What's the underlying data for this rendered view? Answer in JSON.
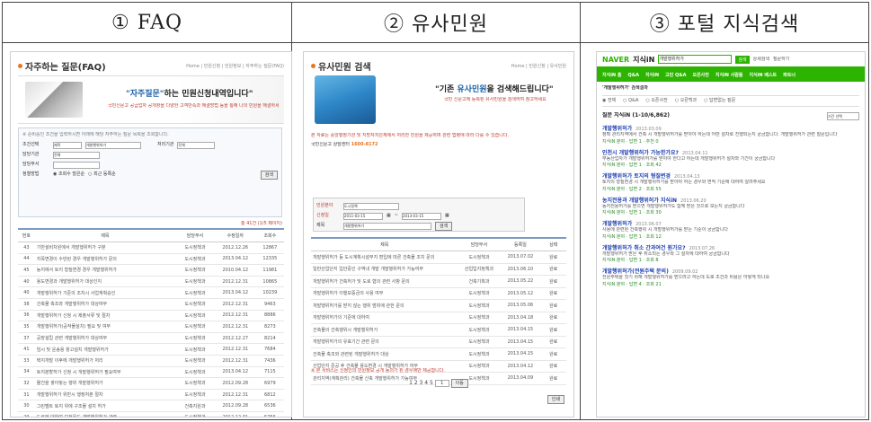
{
  "headers": [
    "① FAQ",
    "② 유사민원",
    "③ 포털 지식검색"
  ],
  "faq": {
    "title": "자주하는 질문(FAQ)",
    "breadcrumb": "Home | 민원신청 | 민원정보 | 자주하는 질문(FAQ)",
    "slogan_pre": "\"자주질문\"",
    "slogan_post": "하는 민원신청내역입니다\"",
    "subtext": "국민신문고 공급업자 공개창을 다양한 고객만족과 해결방법 등을 통해 나의 민원을 해결하세요",
    "form": {
      "notice": "※ 준비중인 조건을 입력하시면 아래에 해당 자주하는 질문 목록을 조회합니다.",
      "label_search": "조건선택",
      "select_value": "제목",
      "input_value": "개발행위허가",
      "label_category": "처리기관",
      "category_value": "전체",
      "label_org": "담당기관",
      "org_value": "전체",
      "label_dept": "담당부서",
      "label_sort": "정렬방법",
      "sort_options": [
        "조회수 많은순",
        "최근 등록순"
      ],
      "search_button": "검색"
    },
    "count_text": "총 41건 (1/5 페이지)",
    "columns": [
      "번호",
      "제목",
      "담당부서",
      "수정일자",
      "조회수"
    ],
    "rows": [
      [
        "43",
        "기반설비차원에서 개발행위허가 구분",
        "도시정책과",
        "2012.12.26",
        "12867"
      ],
      [
        "44",
        "지목변경이 수반된 경우 개발행위허가 문의",
        "도시정책과",
        "2013.04.12",
        "12335"
      ],
      [
        "45",
        "농지에서 토지 형질변경 경우 개발행위허가",
        "도시정책과",
        "2010.04.12",
        "11981"
      ],
      [
        "40",
        "용도변경과 개발행위허가 대상인지",
        "도시정책과",
        "2012.12.31",
        "10865"
      ],
      [
        "40",
        "개발행위허가 기준의 조치시 사업계획승인",
        "도시정책과",
        "2013.04.12",
        "10239"
      ],
      [
        "38",
        "건축물 축조와 개발행위허가 대상여부",
        "도시정책과",
        "2012.12.31",
        "9463"
      ],
      [
        "36",
        "개발행위허가 신청 시 제출서류 및 절차",
        "도시정책과",
        "2012.12.31",
        "8886"
      ],
      [
        "35",
        "개발행위허가(공작물설치) 필요 및 여부",
        "도시정책과",
        "2012.12.31",
        "8273"
      ],
      [
        "37",
        "공장설립 관련 개발행위허가 대상여부",
        "도시정책과",
        "2012.12.27",
        "8214"
      ],
      [
        "41",
        "임시 및 운송용 창고설치 개발행위허가",
        "도시정책과",
        "2012.12.31",
        "7684"
      ],
      [
        "33",
        "택지개발 이후에 개발행위허가 처리",
        "도시정책과",
        "2012.12.31",
        "7436"
      ],
      [
        "34",
        "토지분할허가 신청 시 개발행위허가 필요여부",
        "도시정책과",
        "2013.04.12",
        "7115"
      ],
      [
        "32",
        "물건을 쌓아놓는 행위 개발행위허가",
        "도시정책과",
        "2012.09.28",
        "6979"
      ],
      [
        "31",
        "개발행위허가 위반시 행정처분 절차",
        "도시정책과",
        "2012.12.31",
        "6812"
      ],
      [
        "30",
        "그린벨트 토지 위에 구조물 설치 허가",
        "건축지원과",
        "2012.09.28",
        "6536"
      ],
      [
        "29",
        "도로에 대하여 보전용도 개발행위허가 관련",
        "도시정책과",
        "2012.12.31",
        "5756"
      ]
    ]
  },
  "similar": {
    "title": "유사민원 검색",
    "breadcrumb": "Home | 민원신청 | 유사민원",
    "slogan_pre": "\"기존 ",
    "slogan_mid": "유사민원",
    "slogan_post": "을 검색해드립니다\"",
    "subtext": "국민 신문고에 등록된 유사민원을 검색하여 참고하세요",
    "info_text": "본 자료는 중앙행정기관 및 지방자치단체에서 처리한 민원을 제공하며 관련 법령에 따라 다를 수 있습니다.",
    "phone_label": "국민신문고 상담센터",
    "phone": "1600-8172",
    "form": {
      "label_field": "민원분야",
      "field_value": "도시정책",
      "label_period": "신청일",
      "date_from": "2011-03-15",
      "date_to": "2013-03-15",
      "label_keyword": "제목",
      "keyword": "개발행위허가",
      "search_button": "검색"
    },
    "columns": [
      "제목",
      "담당부서",
      "등록일",
      "상태"
    ],
    "rows": [
      [
        "개발행위허가 등 도시계획시설부지 편입에 따른 건축물 조치 문의",
        "도시정책과",
        "2013.07.02",
        "완료"
      ],
      [
        "일반산업단지 입안중인 구역내 개발 개발행위허가 가능여부",
        "산업입지정책과",
        "2013.06.10",
        "완료"
      ],
      [
        "개발행위허가 건축허가 및 도로 협의 관련 사항 문의",
        "건축기획과",
        "2013.05.22",
        "완료"
      ],
      [
        "개발행위허가 이행보증금의 사용 여부",
        "도시정책과",
        "2013.05.12",
        "완료"
      ],
      [
        "개발행위허가를 받지 않는 행위 범위에 관한 문의",
        "도시정책과",
        "2013.05.06",
        "완료"
      ],
      [
        "개발행위허가의 기준에 대하여",
        "도시정책과",
        "2013.04.18",
        "완료"
      ],
      [
        "건축물의 건축행위시 개발행위허가",
        "도시정책과",
        "2013.04.15",
        "완료"
      ],
      [
        "개발행위허가의 유효기간 관련 문의",
        "도시정책과",
        "2013.04.15",
        "완료"
      ],
      [
        "건축물 축조와 관련된 개발행위허가 대상",
        "도시정책과",
        "2013.04.15",
        "완료"
      ],
      [
        "산업단지 준공 후 건축물 용도변경 시 개발행위허가 여부",
        "도시정책과",
        "2013.04.12",
        "완료"
      ],
      [
        "관리지역(계획관리) 건축물 신축 개발행위허가 가능여부",
        "도시정책과",
        "2013.04.09",
        "완료"
      ]
    ],
    "footer_note": "※ 본 서비스는 신청인의 민원정보 공개 동의가 된 경우에만 제공합니다.",
    "pages": "1 2 3 4 5",
    "page_select": "1",
    "go_button": "이동",
    "print_button": "인쇄"
  },
  "portal": {
    "logo": "NAVER",
    "logo2": "지식iN",
    "search_value": "개발행위허가",
    "search_button": "검색",
    "top_links": [
      "상세검색",
      "질문하기"
    ],
    "nav": [
      "지식iN 홈",
      "Q&A",
      "지식iN",
      "고민 Q&A",
      "오픈사전",
      "지식iN 사람들",
      "지식iN 베스트",
      "파트너"
    ],
    "query_line": "'개발행위허가' 검색결과",
    "filters": [
      "전체",
      "Q&A",
      "오픈사전",
      "오픈백과",
      "답변없는 질문"
    ],
    "section_title": "질문 지식iN (1-10/6,862)",
    "sort_label": "기간 선택",
    "results": [
      {
        "title": "개발행위허가",
        "date": "2013.03.09",
        "body": "정확 관리지역에서 건축 시 개발행위허가를 받아야 하는데 어떤 절차로 진행되는지 궁금합니다. 개발행위허가 관련 질문입니다",
        "meta": "지식iN 분야 · 답변 1 · 추천 0"
      },
      {
        "title": "인천시 개발행위허가 가능한가요?",
        "date": "2013.04.11",
        "body": "부동산업자가 개발행위허가를 받아야 한다고 하는데 개발행위허가 절차와 기간이 궁금합니다",
        "meta": "지식iN 분야 · 답변 1 · 조회 42"
      },
      {
        "title": "개발행위허가 토지의 형질변경",
        "date": "2013.04.13",
        "body": "토지의 형질변경 시 개발행위허가를 받아야 하는 경우와 면적 기준에 대하여 알려주세요",
        "meta": "지식iN 분야 · 답변 2 · 조회 55"
      },
      {
        "title": "농지전용과 개발행위허가 지식iN",
        "date": "2013.06.20",
        "body": "농지전용허가를 받으면 개발행위허가도 함께 받은 것으로 보는지 궁금합니다",
        "meta": "지식iN 분야 · 답변 1 · 조회 30"
      },
      {
        "title": "개발행위허가",
        "date": "2013.06.07",
        "body": "사용에 관련된 건축행위 시 개발행위허가를 받는 기준이 궁금합니다",
        "meta": "지식iN 분야 · 답변 1 · 조회 12"
      },
      {
        "title": "개발행위허가 취소 간과여건 뭔가요?",
        "date": "2013.07.26",
        "body": "개발행위허가 받은 후 취소되는 경우와 그 절차에 대하여 궁금합니다",
        "meta": "지식iN 분야 · 답변 1 · 조회 8"
      },
      {
        "title": "개발행위허가(전원주택 문의)",
        "date": "2009.09.02",
        "body": "전원주택을 짓기 위해 개발행위허가를 받으려고 하는데 도로 조건과 비용은 어떻게 되나요",
        "meta": "지식iN 분야 · 답변 4 · 조회 21"
      }
    ]
  }
}
